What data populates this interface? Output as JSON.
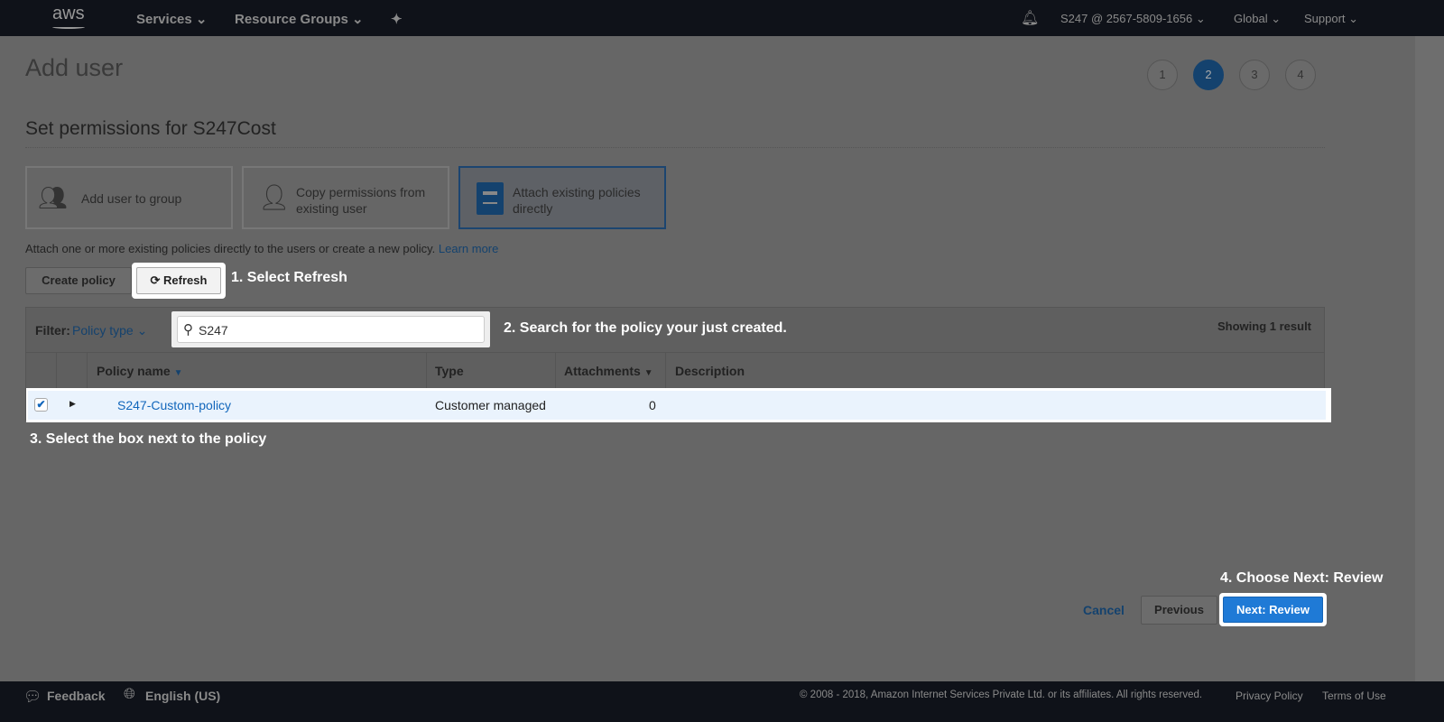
{
  "topbar": {
    "logo": "aws",
    "services": "Services",
    "resource_groups": "Resource Groups",
    "account": "S247 @ 2567-5809-1656",
    "region": "Global",
    "support": "Support"
  },
  "page": {
    "title": "Add user",
    "steps": [
      "1",
      "2",
      "3",
      "4"
    ],
    "active_step": 2,
    "section_title": "Set permissions for S247Cost"
  },
  "options": [
    {
      "label": "Add user to group"
    },
    {
      "label": "Copy permissions from existing user"
    },
    {
      "label": "Attach existing policies directly"
    }
  ],
  "description": "Attach one or more existing policies directly to the users or create a new policy.",
  "learn_more": "Learn more",
  "buttons": {
    "create_policy": "Create policy",
    "refresh": "Refresh",
    "cancel": "Cancel",
    "previous": "Previous",
    "next": "Next: Review"
  },
  "filter": {
    "label": "Filter:",
    "type": "Policy type",
    "search_value": "S247",
    "result_count": "Showing 1 result"
  },
  "table": {
    "headers": [
      "Policy name",
      "Type",
      "Attachments",
      "Description"
    ],
    "rows": [
      {
        "checked": true,
        "name": "S247-Custom-policy",
        "type": "Customer managed",
        "attachments": "0",
        "description": ""
      }
    ]
  },
  "annotations": [
    "1. Select Refresh",
    "2. Search for the policy your just created.",
    "3. Select the box next to the policy",
    "4. Choose Next: Review"
  ],
  "footer": {
    "feedback": "Feedback",
    "language": "English (US)",
    "copyright": "© 2008 - 2018, Amazon Internet Services Private Ltd. or its affiliates. All rights reserved.",
    "privacy": "Privacy Policy",
    "terms": "Terms of Use"
  }
}
